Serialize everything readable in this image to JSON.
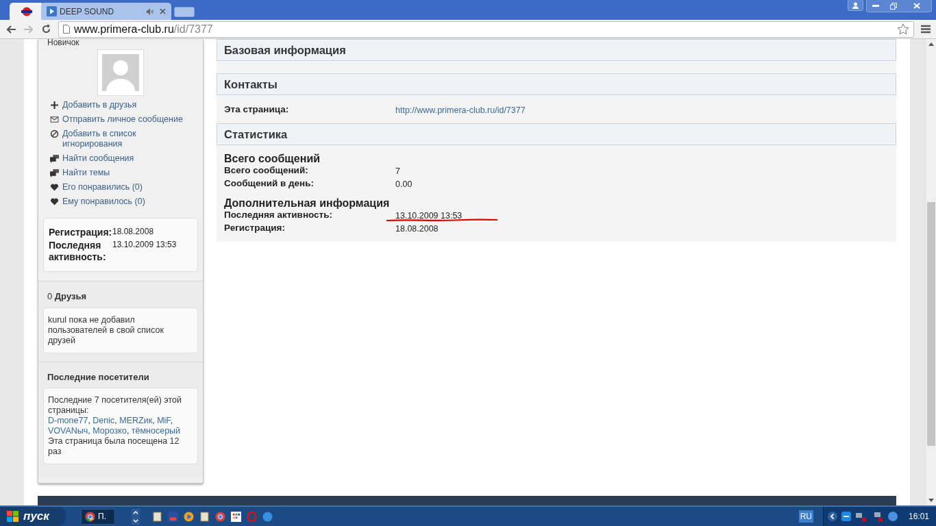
{
  "browser": {
    "tabs": [
      {
        "kind": "site",
        "selected": true
      },
      {
        "kind": "media",
        "title": "DEEP SOUND",
        "selected": false
      }
    ],
    "address": {
      "host": "www.primera-club.ru",
      "path": "/id/7377"
    }
  },
  "sidebar": {
    "rank": "Новичок",
    "actions": [
      {
        "kind": "add",
        "label": "Добавить в друзья"
      },
      {
        "kind": "mail",
        "label": "Отправить личное сообщение"
      },
      {
        "kind": "block",
        "label": "Добавить в список игнорирования"
      },
      {
        "kind": "chat",
        "label": "Найти сообщения"
      },
      {
        "kind": "chat",
        "label": "Найти темы"
      },
      {
        "kind": "heart",
        "label": "Его понравились (0)"
      },
      {
        "kind": "heart",
        "label": "Ему понравилось (0)"
      }
    ],
    "info": [
      {
        "label": "Регистрация:",
        "value": "18.08.2008"
      },
      {
        "label": "Последняя активность:",
        "value": "13.10.2009 13:53"
      }
    ],
    "friends": {
      "count": "0",
      "title": "Друзья",
      "text": "kurul пока не добавил пользователей в свой список друзей"
    },
    "visitors": {
      "title": "Последние посетители",
      "intro": "Последние 7 посетителя(ей) этой страницы:",
      "separator": ",",
      "names": [
        "D-mone77",
        "Denic",
        "MERZик",
        "MiF",
        "VOVANыч",
        "Морозко",
        "тёмносерый"
      ],
      "footer": "Эта страница была посещена 12 раз"
    }
  },
  "main": {
    "sections": [
      {
        "title": "Базовая информация"
      },
      {
        "title": "Контакты",
        "groups": [
          {
            "rows": [
              {
                "label": "Эта страница:",
                "value": "http://www.primera-club.ru/id/7377",
                "kind": "link",
                "underlined": false
              }
            ]
          }
        ]
      },
      {
        "title": "Статистика",
        "groups": [
          {
            "title": "Всего сообщений",
            "rows": [
              {
                "label": "Всего сообщений:",
                "value": "7",
                "kind": "text",
                "underlined": false
              },
              {
                "label": "Сообщений в день:",
                "value": "0.00",
                "kind": "text",
                "underlined": false
              }
            ]
          },
          {
            "title": "Дополнительная информация",
            "rows": [
              {
                "label": "Последняя активность:",
                "value": "13.10.2009 13:53",
                "kind": "text",
                "underlined": true
              },
              {
                "label": "Регистрация:",
                "value": "18.08.2008",
                "kind": "text",
                "underlined": false
              }
            ]
          }
        ]
      }
    ]
  },
  "taskbar": {
    "start": "пуск",
    "window": "П.",
    "language": "RU",
    "clock": "16:01"
  }
}
